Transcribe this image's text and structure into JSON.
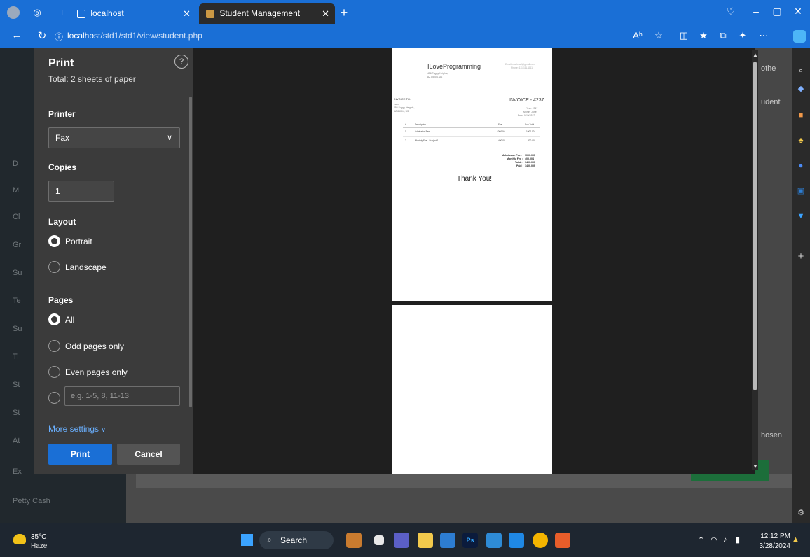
{
  "browser": {
    "tabs": [
      {
        "label": "localhost"
      },
      {
        "label": "Student Management System",
        "active": true
      }
    ],
    "url_host": "localhost",
    "url_path": "/std1/std1/view/student.php",
    "read_aloud_label": "Aʰ"
  },
  "background_page": {
    "sidebar_items": [
      "D",
      "M",
      "Cl",
      "Gr",
      "Su",
      "Te",
      "Su",
      "Ti",
      "St",
      "St",
      "At",
      "Ex",
      "Petty Cash"
    ],
    "right_texts": [
      "othe",
      "udent",
      "hosen"
    ]
  },
  "print_dialog": {
    "title": "Print",
    "total": "Total: 2 sheets of paper",
    "help": "?",
    "printer_label": "Printer",
    "printer_value": "Fax",
    "copies_label": "Copies",
    "copies_value": "1",
    "layout_label": "Layout",
    "layout_options": [
      "Portrait",
      "Landscape"
    ],
    "layout_selected": "Portrait",
    "pages_label": "Pages",
    "pages_options": [
      "All",
      "Odd pages only",
      "Even pages only"
    ],
    "pages_selected": "All",
    "page_range_placeholder": "e.g. 1-5, 8, 11-13",
    "more_settings": "More settings",
    "print_button": "Print",
    "cancel_button": "Cancel"
  },
  "preview": {
    "brand": "ILoveProgramming",
    "brand_address": [
      "456 Foggy Heights,",
      "AZ 85004, US"
    ],
    "contact": [
      "Email: mail.mail@gmail.com",
      "Phone: 111-111-1111"
    ],
    "invoice_to_label": "INVOICE TO:",
    "invoice_to": [
      "Lam",
      "456 Foggy Heights,",
      "AZ 85004, US"
    ],
    "invoice_title": "INVOICE - #237",
    "invoice_meta": [
      "Year: 2017",
      "Month: June",
      "Date: 12/6/2017"
    ],
    "table_headers": [
      "#",
      "Description",
      "Fee",
      "Sub Total"
    ],
    "table_rows": [
      [
        "1",
        "Admission Fee",
        "1000.00",
        "1000.00"
      ],
      [
        "2",
        "Monthly Fee - Subject 1",
        "400.00",
        "400.00"
      ]
    ],
    "totals": [
      [
        "Admission Fee :",
        "1000.00$"
      ],
      [
        "Monthly Fee :",
        "400.00$"
      ],
      [
        "Total :",
        "1400.00$"
      ],
      [
        "Paid :",
        "1400.00$"
      ]
    ],
    "thank_you": "Thank You!"
  },
  "taskbar": {
    "temperature": "35°C",
    "weather": "Haze",
    "search_placeholder": "Search",
    "time": "12:12 PM",
    "date": "3/28/2024"
  }
}
